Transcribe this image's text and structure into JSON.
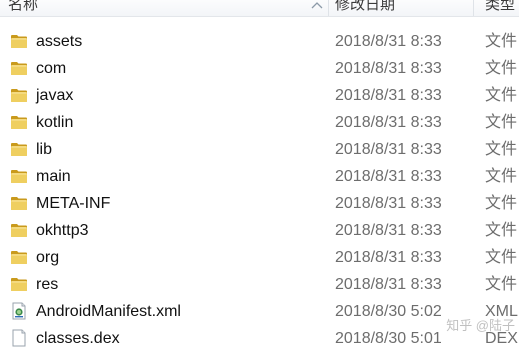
{
  "columns": {
    "name": "名称",
    "date_modified": "修改日期",
    "type": "类型"
  },
  "items": [
    {
      "name": "assets",
      "date": "2018/8/31 8:33",
      "type": "文件",
      "icon": "folder-icon"
    },
    {
      "name": "com",
      "date": "2018/8/31 8:33",
      "type": "文件",
      "icon": "folder-icon"
    },
    {
      "name": "javax",
      "date": "2018/8/31 8:33",
      "type": "文件",
      "icon": "folder-icon"
    },
    {
      "name": "kotlin",
      "date": "2018/8/31 8:33",
      "type": "文件",
      "icon": "folder-icon"
    },
    {
      "name": "lib",
      "date": "2018/8/31 8:33",
      "type": "文件",
      "icon": "folder-icon"
    },
    {
      "name": "main",
      "date": "2018/8/31 8:33",
      "type": "文件",
      "icon": "folder-icon"
    },
    {
      "name": "META-INF",
      "date": "2018/8/31 8:33",
      "type": "文件",
      "icon": "folder-icon"
    },
    {
      "name": "okhttp3",
      "date": "2018/8/31 8:33",
      "type": "文件",
      "icon": "folder-icon"
    },
    {
      "name": "org",
      "date": "2018/8/31 8:33",
      "type": "文件",
      "icon": "folder-icon"
    },
    {
      "name": "res",
      "date": "2018/8/31 8:33",
      "type": "文件",
      "icon": "folder-icon"
    },
    {
      "name": "AndroidManifest.xml",
      "date": "2018/8/30 5:02",
      "type": "XML",
      "icon": "xml-file-icon"
    },
    {
      "name": "classes.dex",
      "date": "2018/8/30 5:01",
      "type": "DEX",
      "icon": "file-icon"
    }
  ],
  "watermark": "知乎 @陆子",
  "colors": {
    "folder": "#e8c24a",
    "folder_dark": "#c99a1c",
    "header_separator": "#dfe3e8",
    "secondary_text": "#6d6d6d"
  }
}
